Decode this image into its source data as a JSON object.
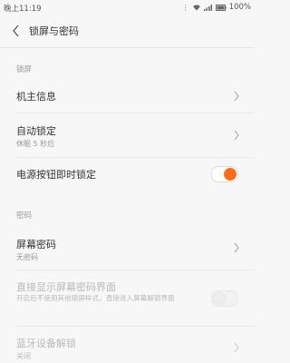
{
  "status_bar": {
    "time": "晚上11:19",
    "battery": "100%"
  },
  "header": {
    "title": "锁屏与密码"
  },
  "sections": {
    "lock": {
      "header": "锁屏",
      "owner_info": "机主信息",
      "auto_lock": "自动锁定",
      "auto_lock_value": "休眠 5 秒后",
      "power_button_lock": "电源按钮即时锁定",
      "power_button_lock_on": true
    },
    "password": {
      "header": "密码",
      "screen_password": "屏幕密码",
      "screen_password_value": "无密码",
      "show_password_screen": "直接显示屏幕密码界面",
      "show_password_screen_desc": "开启后不使用其他锁屏样式，直接进入屏幕解锁界面",
      "show_password_screen_on": false,
      "bluetooth_unlock": "蓝牙设备解锁",
      "bluetooth_unlock_value": "关闭"
    }
  },
  "colors": {
    "accent": "#ff6f1a",
    "background": "#f7f7f7"
  }
}
